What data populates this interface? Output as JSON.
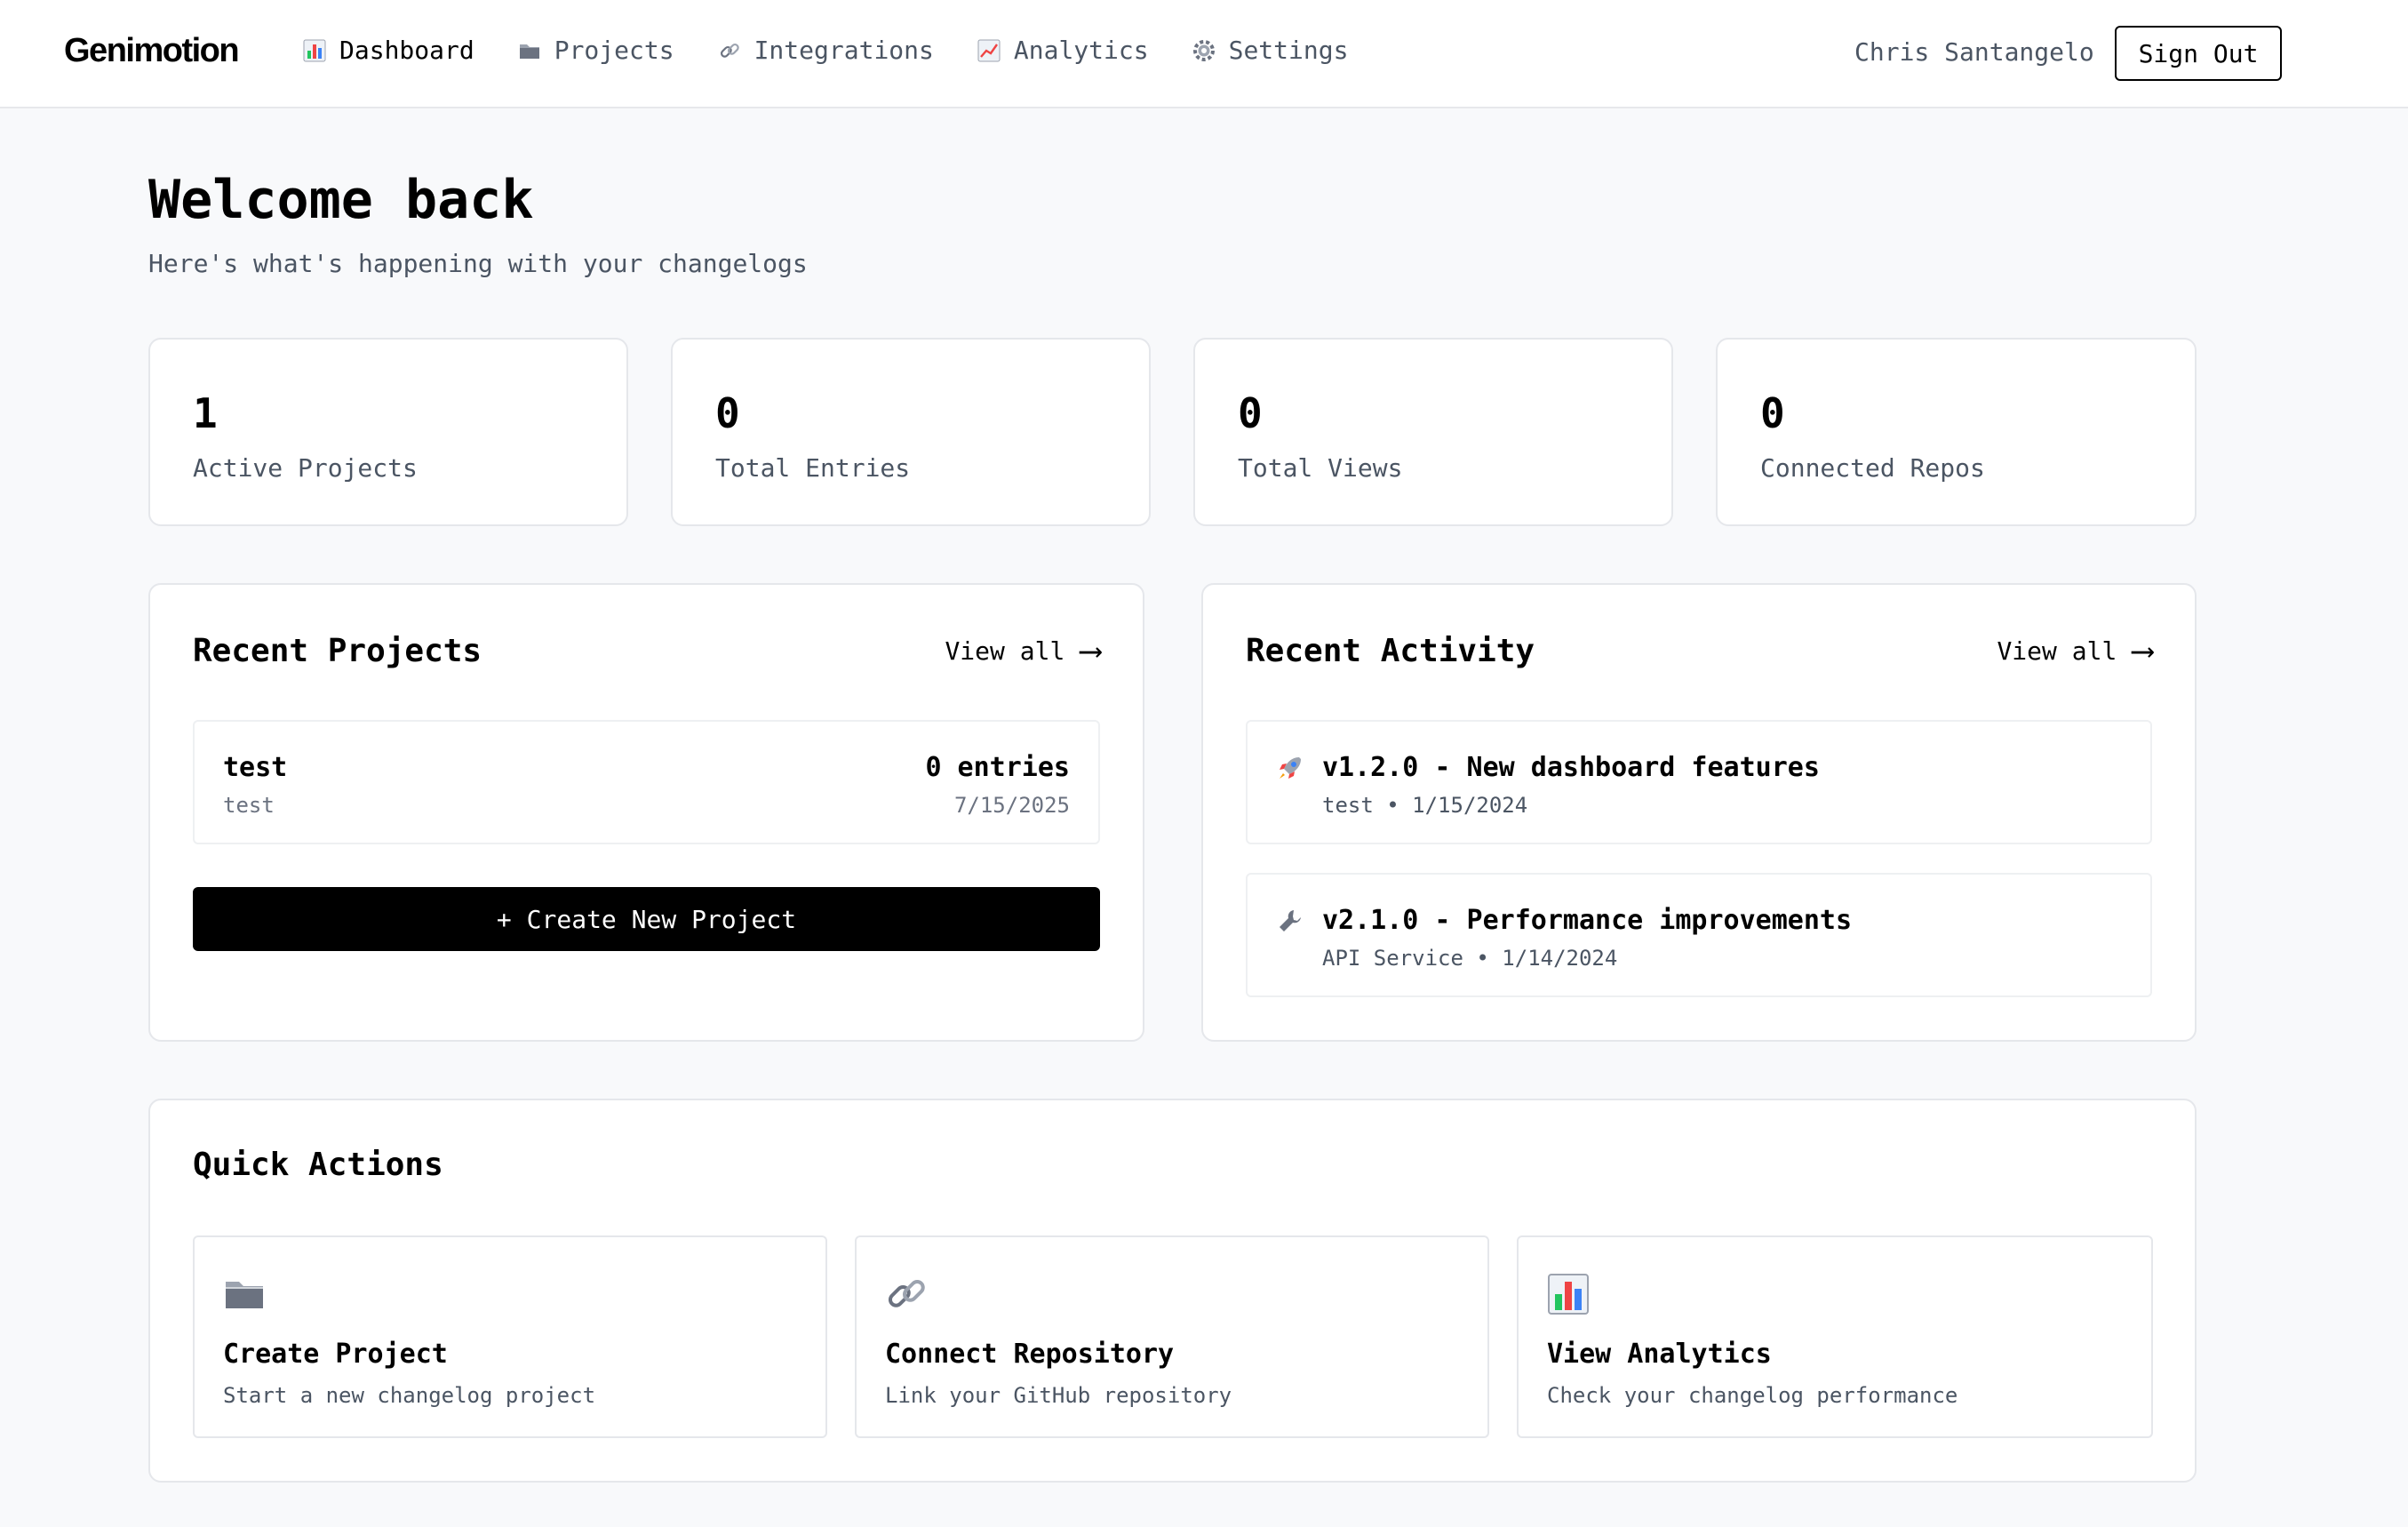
{
  "brand": "Genimotion",
  "nav": [
    {
      "label": "Dashboard",
      "icon": "bar-chart-icon",
      "active": true
    },
    {
      "label": "Projects",
      "icon": "folder-icon",
      "active": false
    },
    {
      "label": "Integrations",
      "icon": "link-icon",
      "active": false
    },
    {
      "label": "Analytics",
      "icon": "line-chart-icon",
      "active": false
    },
    {
      "label": "Settings",
      "icon": "gear-icon",
      "active": false
    }
  ],
  "user": {
    "name": "Chris Santangelo",
    "signout_label": "Sign Out"
  },
  "header": {
    "title": "Welcome back",
    "subtitle": "Here's what's happening with your changelogs"
  },
  "stats": [
    {
      "value": "1",
      "label": "Active Projects"
    },
    {
      "value": "0",
      "label": "Total Entries"
    },
    {
      "value": "0",
      "label": "Total Views"
    },
    {
      "value": "0",
      "label": "Connected Repos"
    }
  ],
  "recent_projects": {
    "title": "Recent Projects",
    "view_all": "View all",
    "items": [
      {
        "name": "test",
        "description": "test",
        "count": "0 entries",
        "date": "7/15/2025"
      }
    ],
    "create_label": "+ Create New Project"
  },
  "recent_activity": {
    "title": "Recent Activity",
    "view_all": "View all",
    "items": [
      {
        "icon": "rocket-icon",
        "title": "v1.2.0 - New dashboard features",
        "meta": "test • 1/15/2024"
      },
      {
        "icon": "wrench-icon",
        "title": "v2.1.0 - Performance improvements",
        "meta": "API Service • 1/14/2024"
      }
    ]
  },
  "quick_actions": {
    "title": "Quick Actions",
    "items": [
      {
        "icon": "folder-icon",
        "title": "Create Project",
        "description": "Start a new changelog project"
      },
      {
        "icon": "link-icon",
        "title": "Connect Repository",
        "description": "Link your GitHub repository"
      },
      {
        "icon": "bar-chart-icon",
        "title": "View Analytics",
        "description": "Check your changelog performance"
      }
    ]
  },
  "colors": {
    "accent": "#000000",
    "background": "#f8f9fb",
    "muted_text": "#4b5563",
    "border": "#e5e7eb"
  }
}
